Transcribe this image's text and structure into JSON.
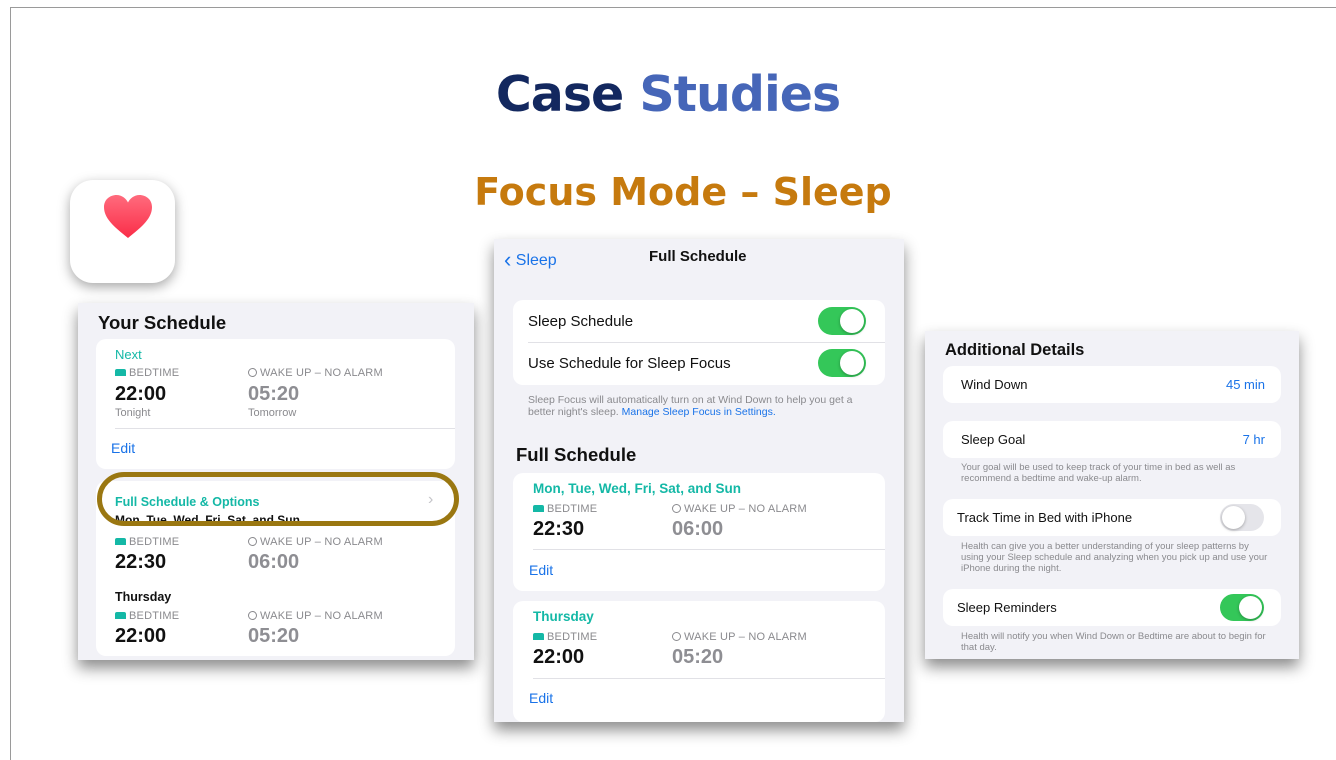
{
  "slide": {
    "title_word1": "Case",
    "title_word2": "Studies",
    "subtitle": "Focus Mode – Sleep",
    "app_icon": "heart-icon",
    "colors": {
      "title_dark": "#13285f",
      "title_light": "#4666b8",
      "subtitle": "#c67a0e",
      "highlight": "#9a7711",
      "teal": "#14b8a6",
      "toggle_on": "#34c759",
      "link": "#1a73e8"
    }
  },
  "left": {
    "title": "Your Schedule",
    "next_label": "Next",
    "bedtime_label": "BEDTIME",
    "wake_label": "WAKE UP – NO ALARM",
    "bedtime": "22:00",
    "wake": "05:20",
    "bed_sub": "Tonight",
    "wake_sub": "Tomorrow",
    "edit": "Edit",
    "full_link": "Full Schedule & Options",
    "days_cut": "Mon, Tue, Wed, Fri, Sat, and Sun",
    "row1": {
      "bedtime_label": "BEDTIME",
      "wake_label": "WAKE UP – NO ALARM",
      "bedtime": "22:30",
      "wake": "06:00"
    },
    "thursday": "Thursday",
    "row2": {
      "bedtime_label": "BEDTIME",
      "wake_label": "WAKE UP – NO ALARM",
      "bedtime": "22:00",
      "wake": "05:20"
    }
  },
  "middle": {
    "back": "Sleep",
    "nav_title": "Full Schedule",
    "sleep_schedule": "Sleep Schedule",
    "sleep_schedule_on": true,
    "use_focus": "Use Schedule for Sleep Focus",
    "use_focus_on": true,
    "note": "Sleep Focus will automatically turn on at Wind Down to help you get a better night's sleep.",
    "note_link": "Manage Sleep Focus in Settings.",
    "section": "Full Schedule",
    "card1": {
      "days": "Mon, Tue, Wed, Fri, Sat, and Sun",
      "bedtime_label": "BEDTIME",
      "wake_label": "WAKE UP – NO ALARM",
      "bedtime": "22:30",
      "wake": "06:00",
      "edit": "Edit"
    },
    "card2": {
      "days": "Thursday",
      "bedtime_label": "BEDTIME",
      "wake_label": "WAKE UP – NO ALARM",
      "bedtime": "22:00",
      "wake": "05:20",
      "edit": "Edit"
    }
  },
  "right": {
    "title": "Additional Details",
    "wind_down": "Wind Down",
    "wind_down_value": "45 min",
    "sleep_goal": "Sleep Goal",
    "sleep_goal_value": "7 hr",
    "goal_note": "Your goal will be used to keep track of your time in bed as well as recommend a bedtime and wake-up alarm.",
    "track": "Track Time in Bed with iPhone",
    "track_on": false,
    "track_note": "Health can give you a better understanding of your sleep patterns by using your Sleep schedule and analyzing when you pick up and use your iPhone during the night.",
    "reminders": "Sleep Reminders",
    "reminders_on": true,
    "reminders_note": "Health will notify you when Wind Down or Bedtime are about to begin for that day."
  }
}
